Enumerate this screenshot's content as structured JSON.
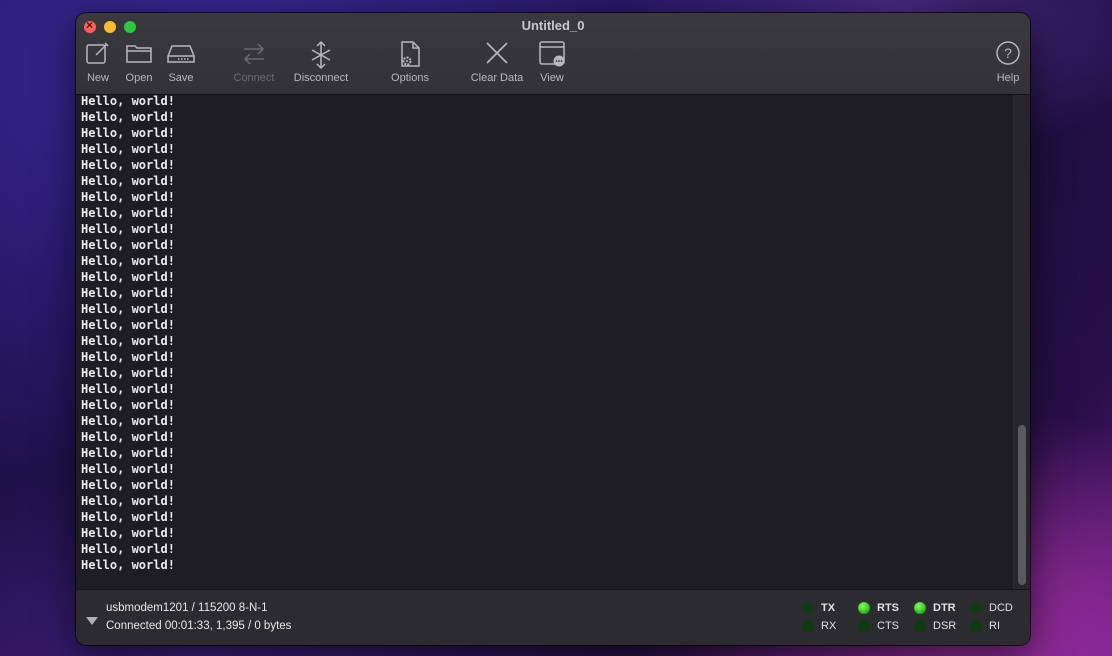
{
  "window": {
    "title": "Untitled_0"
  },
  "toolbar": {
    "new": "New",
    "open": "Open",
    "save": "Save",
    "connect": "Connect",
    "disconnect": "Disconnect",
    "options": "Options",
    "clear_data": "Clear Data",
    "view": "View",
    "help": "Help"
  },
  "terminal": {
    "lines": [
      "Hello, world!",
      "Hello, world!",
      "Hello, world!",
      "Hello, world!",
      "Hello, world!",
      "Hello, world!",
      "Hello, world!",
      "Hello, world!",
      "Hello, world!",
      "Hello, world!",
      "Hello, world!",
      "Hello, world!",
      "Hello, world!",
      "Hello, world!",
      "Hello, world!",
      "Hello, world!",
      "Hello, world!",
      "Hello, world!",
      "Hello, world!",
      "Hello, world!",
      "Hello, world!",
      "Hello, world!",
      "Hello, world!",
      "Hello, world!",
      "Hello, world!",
      "Hello, world!",
      "Hello, world!",
      "Hello, world!",
      "Hello, world!",
      "Hello, world!"
    ]
  },
  "status": {
    "port": "usbmodem1201 / 115200 8-N-1",
    "connection": "Connected 00:01:33, 1,395 / 0 bytes"
  },
  "signals": {
    "tx": {
      "label": "TX",
      "on": false
    },
    "rx": {
      "label": "RX",
      "on": false
    },
    "rts": {
      "label": "RTS",
      "on": true
    },
    "cts": {
      "label": "CTS",
      "on": false
    },
    "dtr": {
      "label": "DTR",
      "on": true
    },
    "dsr": {
      "label": "DSR",
      "on": false
    },
    "dcd": {
      "label": "DCD",
      "on": false
    },
    "ri": {
      "label": "RI",
      "on": false
    }
  }
}
